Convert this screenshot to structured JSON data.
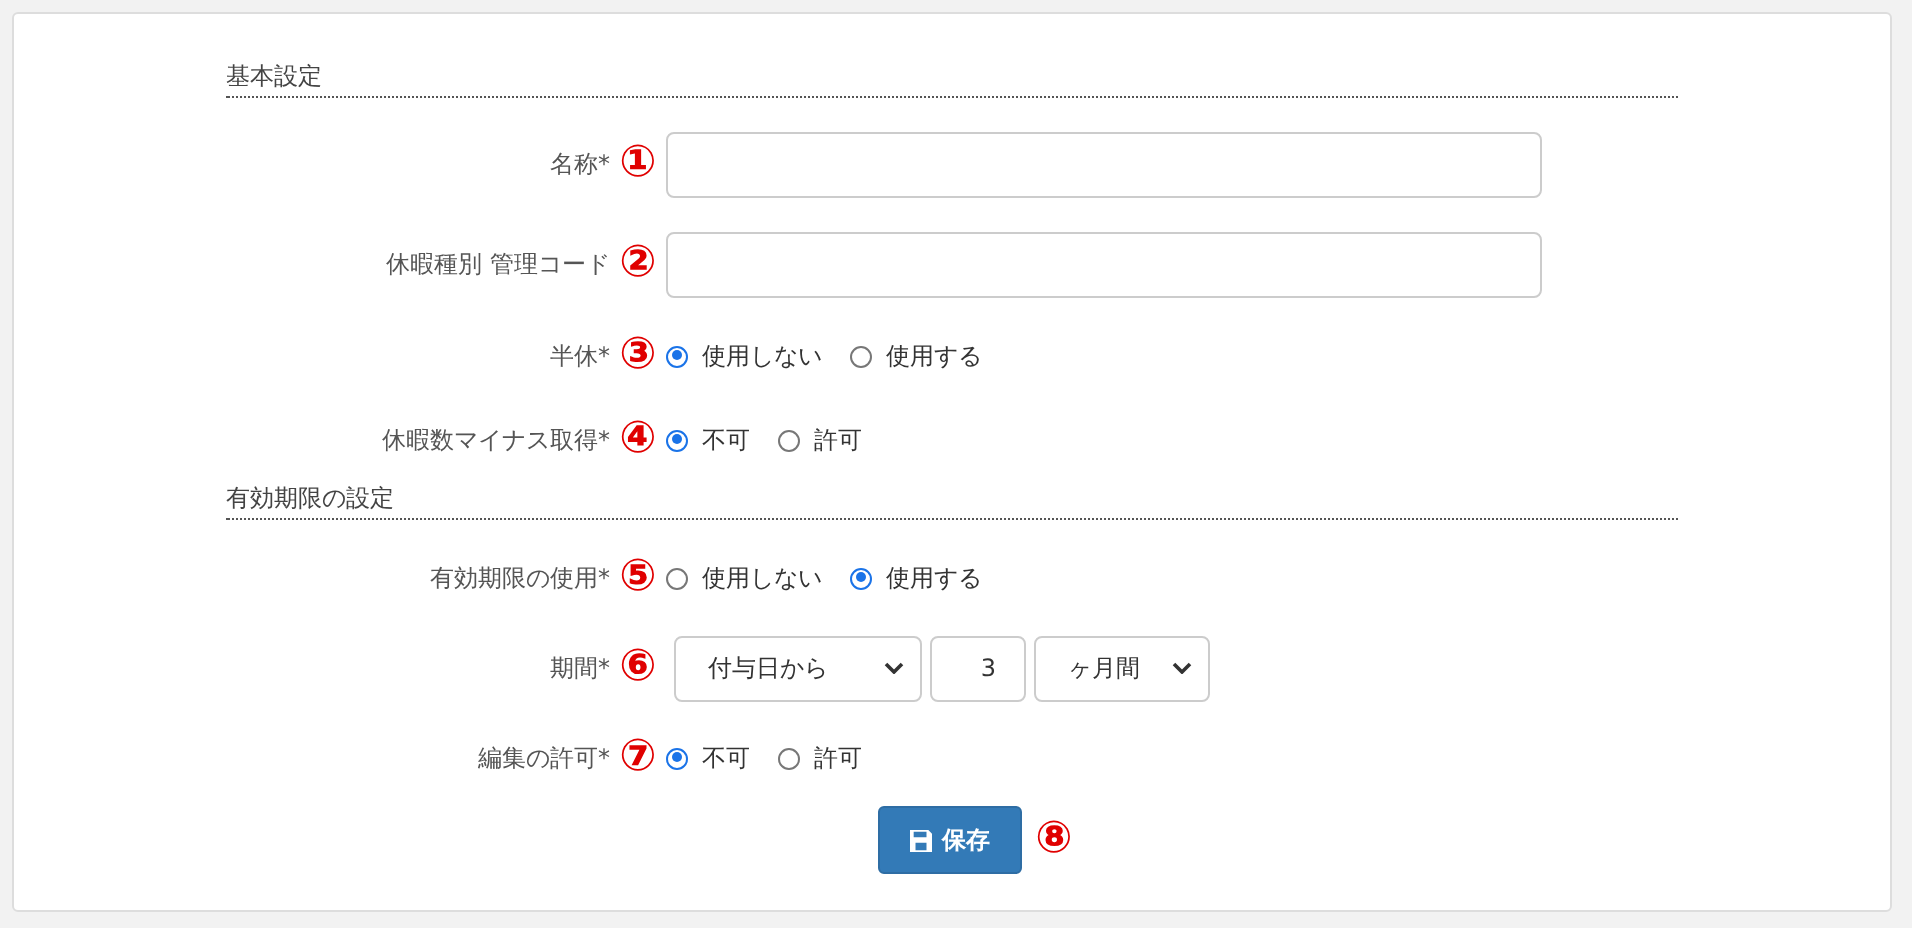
{
  "sections": [
    {
      "heading": "基本設定",
      "rows": [
        {
          "kind": "text",
          "label": "名称*",
          "marker": "①"
        },
        {
          "kind": "text",
          "label": "休暇種別 管理コード",
          "marker": "②"
        },
        {
          "kind": "radio",
          "label": "半休*",
          "marker": "③",
          "options": [
            {
              "label": "使用しない",
              "selected": true
            },
            {
              "label": "使用する",
              "selected": false
            }
          ]
        },
        {
          "kind": "radio",
          "label": "休暇数マイナス取得*",
          "marker": "④",
          "options": [
            {
              "label": "不可",
              "selected": true
            },
            {
              "label": "許可",
              "selected": false
            }
          ]
        }
      ]
    },
    {
      "heading": "有効期限の設定",
      "rows": [
        {
          "kind": "radio",
          "label": "有効期限の使用*",
          "marker": "⑤",
          "options": [
            {
              "label": "使用しない",
              "selected": false
            },
            {
              "label": "使用する",
              "selected": true
            }
          ]
        },
        {
          "kind": "period",
          "label": "期間*",
          "marker": "⑥",
          "base": "付与日から",
          "amount": "3",
          "unit": "ヶ月間"
        },
        {
          "kind": "radio",
          "label": "編集の許可*",
          "marker": "⑦",
          "options": [
            {
              "label": "不可",
              "selected": true
            },
            {
              "label": "許可",
              "selected": false
            }
          ]
        }
      ]
    }
  ],
  "save_button": {
    "label": "保存",
    "marker": "⑧"
  }
}
